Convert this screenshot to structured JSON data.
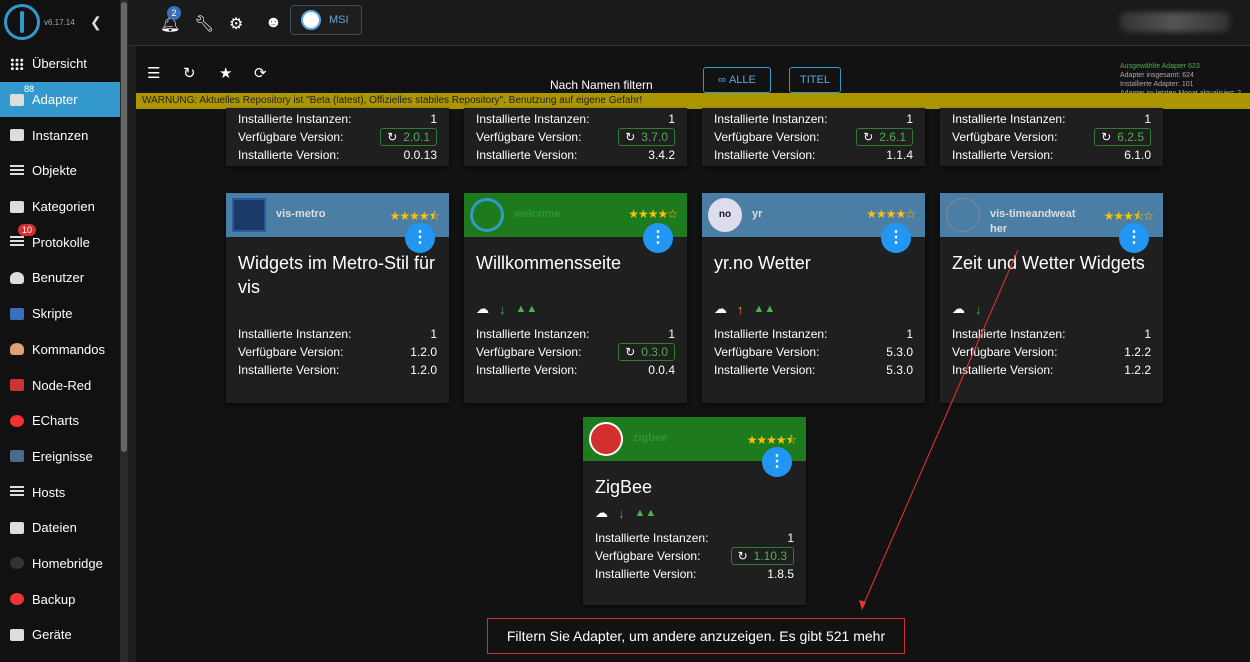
{
  "sidebar": {
    "version": "v6.17.14",
    "items": [
      {
        "label": "Übersicht",
        "icon": "grid-icon"
      },
      {
        "label": "Adapter",
        "icon": "store-icon",
        "badge": "88"
      },
      {
        "label": "Instanzen",
        "icon": "instances-icon"
      },
      {
        "label": "Objekte",
        "icon": "list-icon"
      },
      {
        "label": "Kategorien",
        "icon": "category-icon"
      },
      {
        "label": "Protokolle",
        "icon": "logs-icon",
        "badge": "10"
      },
      {
        "label": "Benutzer",
        "icon": "user-icon"
      },
      {
        "label": "Skripte",
        "icon": "js-icon"
      },
      {
        "label": "Kommandos",
        "icon": "commands-icon"
      },
      {
        "label": "Node-Red",
        "icon": "node-red-icon"
      },
      {
        "label": "ECharts",
        "icon": "echarts-icon"
      },
      {
        "label": "Ereignisse",
        "icon": "events-icon"
      },
      {
        "label": "Hosts",
        "icon": "hosts-icon"
      },
      {
        "label": "Dateien",
        "icon": "files-icon"
      },
      {
        "label": "Homebridge",
        "icon": "homebridge-icon"
      },
      {
        "label": "Backup",
        "icon": "backup-icon"
      },
      {
        "label": "Geräte",
        "icon": "devices-icon"
      }
    ]
  },
  "topbar": {
    "notification_count": "2",
    "host_label": "MSI"
  },
  "toolbar": {
    "filter_label": "Nach Namen filtern",
    "btn_all": "ALLE",
    "btn_title": "TITEL",
    "stats": {
      "selected": "Ausgewählte Adapter 623",
      "total": "Adapter insgesamt: 624",
      "installed": "Installierte Adapter: 101",
      "updated": "Adapter im letzten Monat aktualisiert: 2"
    }
  },
  "warning": "WARNUNG: Aktuelles Repository ist \"Beta (latest), Offizielles stabiles Repository\". Benutzung auf eigene Gefahr!",
  "labels": {
    "installed_instances": "Installierte Instanzen:",
    "available_version": "Verfügbare Version:",
    "installed_version": "Installierte Version:"
  },
  "top_cards": [
    {
      "instances": "1",
      "available": "2.0.1",
      "installed": "0.0.13"
    },
    {
      "instances": "1",
      "available": "3.7.0",
      "installed": "3.4.2"
    },
    {
      "instances": "1",
      "available": "2.6.1",
      "installed": "1.1.4"
    },
    {
      "instances": "1",
      "available": "6.2.5",
      "installed": "6.1.0"
    }
  ],
  "cards": [
    {
      "name": "vis-metro",
      "title": "Widgets im Metro-Stil für vis",
      "instances": "1",
      "available": "1.2.0",
      "installed": "1.2.0",
      "rating": "4.5 of 5"
    },
    {
      "name": "welcome",
      "title": "Willkommensseite",
      "instances": "1",
      "available": "0.3.0",
      "installed": "0.0.4",
      "rating": "4 of 5"
    },
    {
      "name": "yr",
      "title": "yr.no Wetter",
      "instances": "1",
      "available": "5.3.0",
      "installed": "5.3.0",
      "rating": "4 of 5",
      "logo_text": "no"
    },
    {
      "name": "vis-timeandweather",
      "title": "Zeit und Wetter Widgets",
      "instances": "1",
      "available": "1.2.2",
      "installed": "1.2.2",
      "rating": "3.5 of 5"
    },
    {
      "name": "zigbee",
      "title": "ZigBee",
      "instances": "1",
      "available": "1.10.3",
      "installed": "1.8.5",
      "rating": "4.5 of 5"
    }
  ],
  "footer_message": "Filtern Sie Adapter, um andere anzuzeigen. Es gibt 521 mehr"
}
